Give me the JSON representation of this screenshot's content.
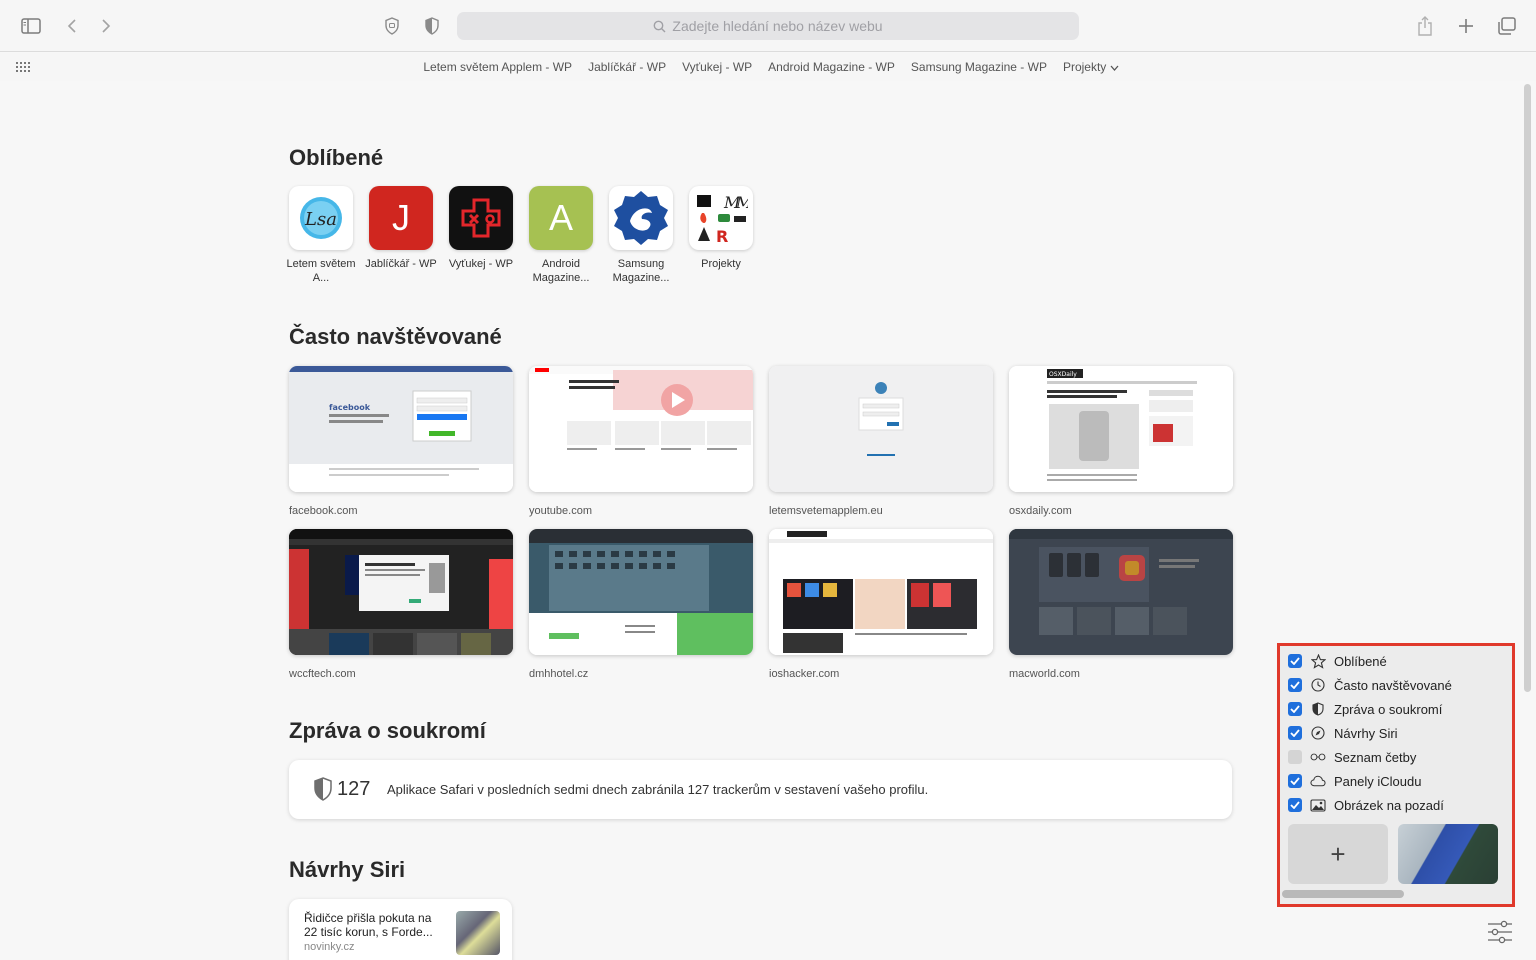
{
  "toolbar": {
    "search_placeholder": "Zadejte hledání nebo název webu"
  },
  "bookmarks_bar": {
    "items": [
      "Letem světem Applem - WP",
      "Jablíčkář - WP",
      "Vyťukej - WP",
      "Android Magazine - WP",
      "Samsung Magazine - WP",
      "Projekty"
    ]
  },
  "favorites": {
    "title": "Oblíbené",
    "items": [
      {
        "label": "Letem světem A...",
        "bg": "#ffffff"
      },
      {
        "label": "Jablíčkář - WP",
        "bg": "#d0261f",
        "glyph": "J"
      },
      {
        "label": "Vyťukej - WP",
        "bg": "#111111"
      },
      {
        "label": "Android Magazine...",
        "bg": "#a6c152",
        "glyph": "A"
      },
      {
        "label": "Samsung Magazine...",
        "bg": "#ffffff"
      },
      {
        "label": "Projekty",
        "bg": "#ffffff"
      }
    ]
  },
  "frequent": {
    "title": "Často navštěvované",
    "items": [
      {
        "label": "facebook.com"
      },
      {
        "label": "youtube.com"
      },
      {
        "label": "letemsvetemapplem.eu"
      },
      {
        "label": "osxdaily.com"
      },
      {
        "label": "wccftech.com"
      },
      {
        "label": "dmhhotel.cz"
      },
      {
        "label": "ioshacker.com"
      },
      {
        "label": "macworld.com"
      }
    ]
  },
  "privacy": {
    "title": "Zpráva o soukromí",
    "count": "127",
    "text": "Aplikace Safari v posledních sedmi dnech zabránila 127 trackerům v sestavení vašeho profilu."
  },
  "siri": {
    "title": "Návrhy Siri",
    "card": {
      "headline": "Řidičce přišla pokuta na 22 tisíc korun, s Forde...",
      "source": "novinky.cz"
    }
  },
  "customize_panel": {
    "options": [
      {
        "label": "Oblíbené",
        "checked": true,
        "icon": "star-icon"
      },
      {
        "label": "Často navštěvované",
        "checked": true,
        "icon": "clock-icon"
      },
      {
        "label": "Zpráva o soukromí",
        "checked": true,
        "icon": "shield-icon"
      },
      {
        "label": "Návrhy Siri",
        "checked": true,
        "icon": "compass-icon"
      },
      {
        "label": "Seznam četby",
        "checked": false,
        "icon": "glasses-icon"
      },
      {
        "label": "Panely iCloudu",
        "checked": true,
        "icon": "cloud-icon"
      },
      {
        "label": "Obrázek na pozadí",
        "checked": true,
        "icon": "image-icon"
      }
    ],
    "add_label": "+"
  },
  "colors": {
    "accent": "#1f6fdc",
    "highlight": "#e0392b"
  }
}
